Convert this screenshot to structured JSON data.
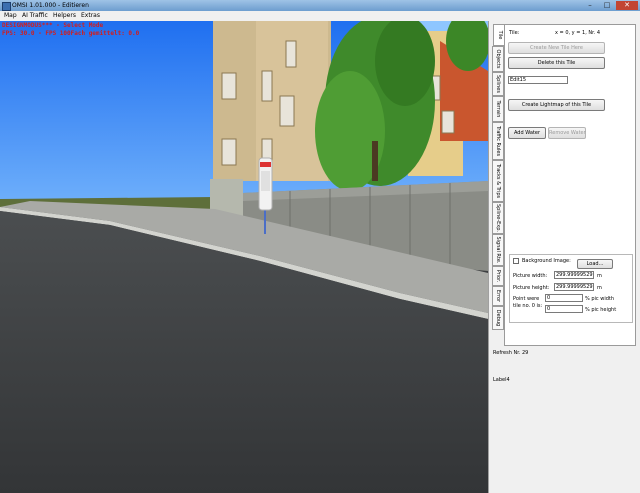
{
  "window": {
    "title": "OMSI 1.01.000 - Editieren",
    "minimize_glyph": "–",
    "maximize_glyph": "□",
    "close_glyph": "✕"
  },
  "menu": [
    "Map",
    "AI Traffic",
    "Helpers",
    "Extras"
  ],
  "viewport": {
    "debug_line1": "DESIGNMODUS*** - Select Mode",
    "debug_line2": "FPS: 30.0 - FPS 100Fach gemittelt: 0.0"
  },
  "tabs": [
    "Tile",
    "Objects",
    "Splines",
    "Terrain",
    "Traffic Rules",
    "Tracks & Trips",
    "Spline-Exp.",
    "Signal Rte.",
    "Prior.",
    "Error",
    "Debug"
  ],
  "tile_panel": {
    "tile_label": "Tile:",
    "tile_coords": "x = 0, y = 1, Nr. 4",
    "create_new_tile_button": "Create New Tile Here",
    "delete_tile_button": "Delete this Tile",
    "tile_name_value": "Edit15",
    "create_lightmap_button": "Create Lightmap of this Tile",
    "add_water_button": "Add Water",
    "remove_water_button": "Remove Water",
    "background_image_label": "Background Image:",
    "load_button": "Load...",
    "picture_width_label": "Picture width:",
    "picture_width_value": "299.999995292",
    "picture_height_label": "Picture height:",
    "picture_height_value": "299.999995292",
    "unit_m": "m",
    "point_label_line1": "Point were",
    "point_label_line2": "tile no. 0 is:",
    "point_x_value": "0",
    "point_y_value": "0",
    "pic_width_suffix": "% pic width",
    "pic_height_suffix": "% pic height"
  },
  "status": {
    "refresh": "Refresh Nr. 29",
    "label4": "Label4"
  },
  "colors": {
    "debug_text": "#d21e1e",
    "sky": "#2a7df5",
    "road": "#3d3f41",
    "titlebar": "#7ba7d8"
  }
}
